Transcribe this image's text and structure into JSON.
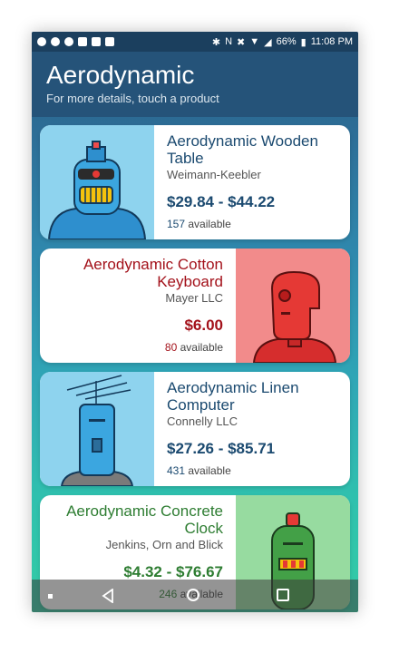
{
  "status": {
    "battery": "66%",
    "time": "11:08 PM"
  },
  "header": {
    "title": "Aerodynamic",
    "subtitle": "For more details, touch a product"
  },
  "products": [
    {
      "name": "Aerodynamic Wooden Table",
      "maker": "Weimann-Keebler",
      "price": "$29.84 - $44.22",
      "count": "157",
      "available_label": "available",
      "color": "#1b4a70",
      "image_bg": "#8ed3ee",
      "robot": "blue robot"
    },
    {
      "name": "Aerodynamic Cotton Keyboard",
      "maker": "Mayer LLC",
      "price": "$6.00",
      "count": "80",
      "available_label": "available",
      "color": "#a3111a",
      "image_bg": "#f28b8b",
      "robot": "red robot"
    },
    {
      "name": "Aerodynamic Linen Computer",
      "maker": "Connelly LLC",
      "price": "$27.26 - $85.71",
      "count": "431",
      "available_label": "available",
      "color": "#1b4a70",
      "image_bg": "#8ed3ee",
      "robot": "blue antenna robot"
    },
    {
      "name": "Aerodynamic Concrete Clock",
      "maker": "Jenkins, Orn and Blick",
      "price": "$4.32 - $76.67",
      "count": "246",
      "available_label": "available",
      "color": "#2e7d32",
      "image_bg": "#97dba0",
      "robot": "green robot"
    }
  ]
}
